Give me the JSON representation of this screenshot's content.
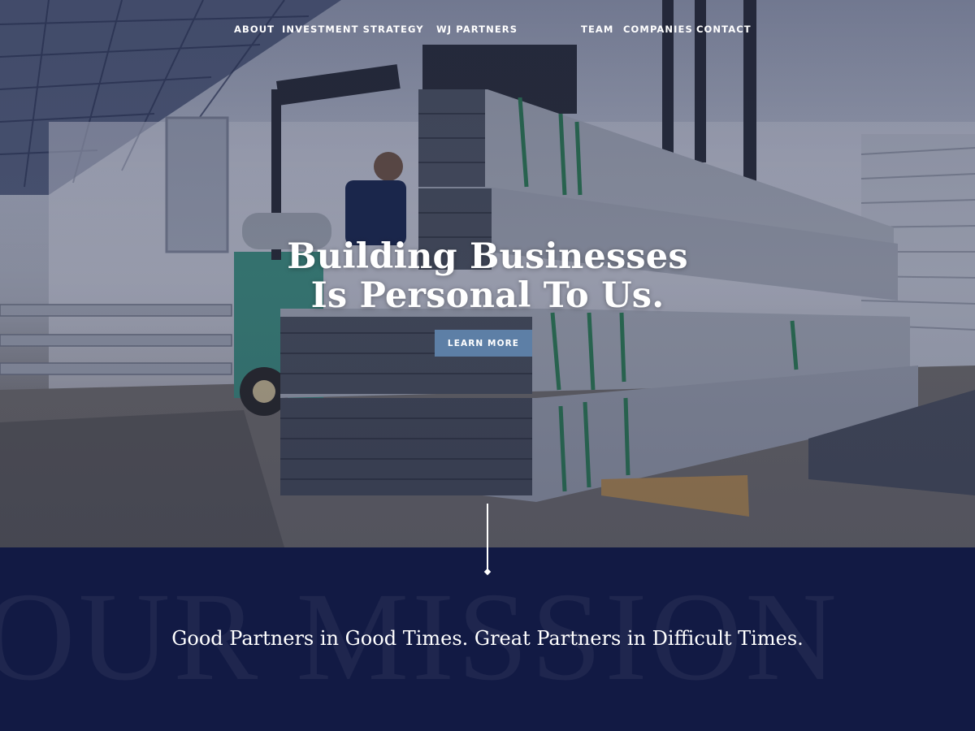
{
  "nav": {
    "left": [
      "ABOUT",
      "INVESTMENT STRATEGY"
    ],
    "logo": "WJ Partners",
    "right": [
      "TEAM",
      "COMPANIES",
      "CONTACT"
    ]
  },
  "hero": {
    "headline_line1": "Building Businesses",
    "headline_line2": "Is Personal To Us.",
    "cta_label": "LEARN MORE"
  },
  "mission": {
    "watermark": "OUR MISSION",
    "tagline": "Good Partners in Good Times. Great Partners in Difficult Times."
  },
  "colors": {
    "navy": "#121a44",
    "cta": "#5d7fa6",
    "white": "#ffffff"
  },
  "icons": [
    "divider-line-icon",
    "diamond-icon"
  ]
}
